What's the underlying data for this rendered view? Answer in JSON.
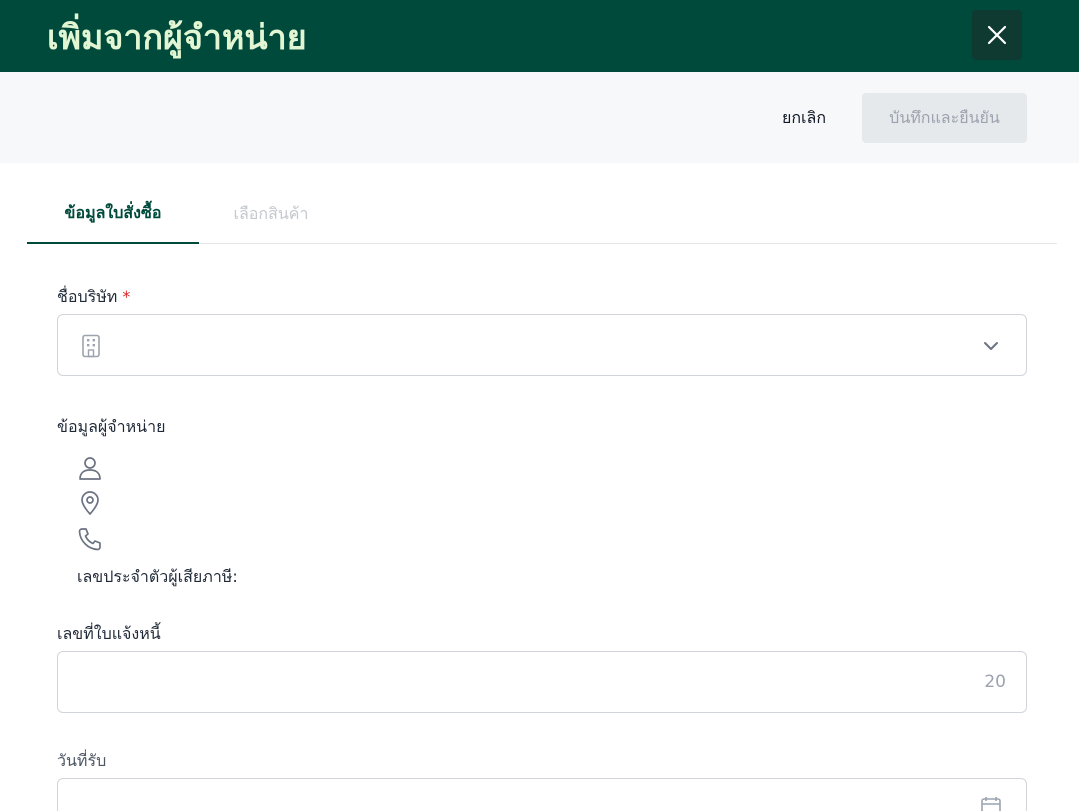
{
  "header": {
    "title": "เพิ่มจากผู้จำหน่าย",
    "close_icon": "close-icon"
  },
  "actions": {
    "cancel_label": "ยกเลิก",
    "save_label": "บันทึกและยืนยัน"
  },
  "tabs": [
    {
      "label": "ข้อมูลใบสั่งซื้อ",
      "active": true
    },
    {
      "label": "เลือกสินค้า",
      "active": false
    }
  ],
  "company": {
    "label": "ชื่อบริษัท",
    "required_mark": "*",
    "value": "",
    "icon": "building-icon"
  },
  "vendor": {
    "label": "ข้อมูลผู้จำหน่าย",
    "icons": [
      "user-icon",
      "location-icon",
      "phone-icon"
    ],
    "tax_id_label": "เลขประจำตัวผู้เสียภาษี:"
  },
  "invoice": {
    "label": "เลขที่ใบแจ้งหนี้",
    "value": "",
    "max_length": "20"
  },
  "receive_date": {
    "label": "วันที่รับ",
    "icon": "calendar-icon"
  },
  "colors": {
    "header_bg": "#004a3b",
    "header_text": "#e3f6d3",
    "accent": "#004a3b",
    "required": "#dc2626"
  }
}
